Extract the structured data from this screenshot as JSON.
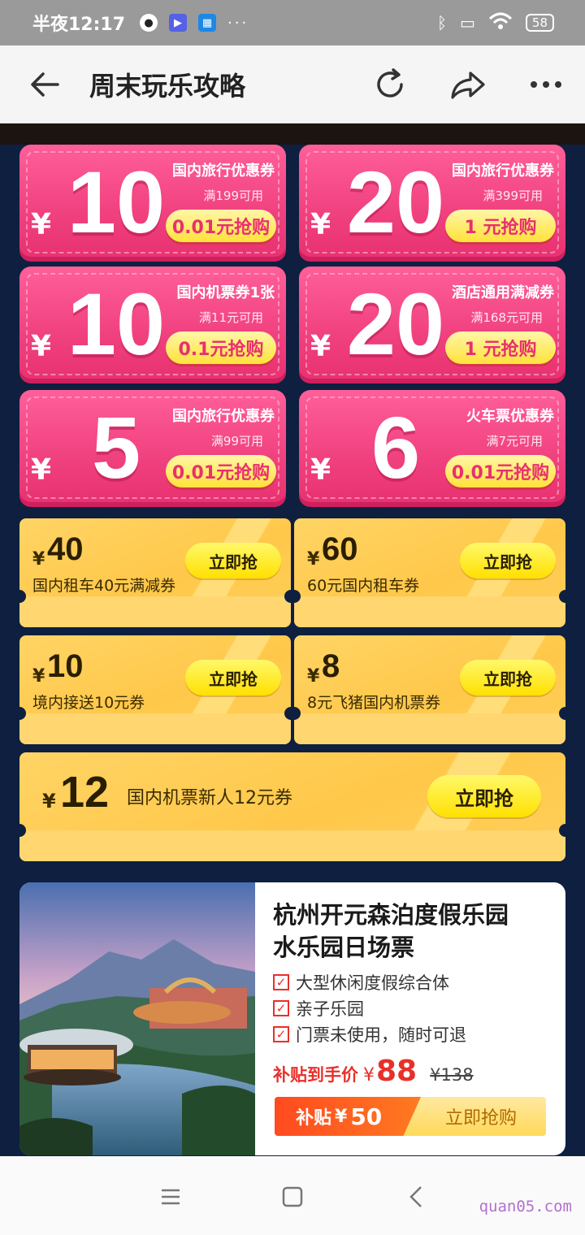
{
  "status": {
    "time": "半夜12:17",
    "app_icons": [
      "qq-icon",
      "video-app-icon",
      "windows-app-icon"
    ],
    "more": "···",
    "battery": "58"
  },
  "header": {
    "title": "周末玩乐攻略",
    "icons": [
      "back-arrow-icon",
      "refresh-icon",
      "share-icon",
      "more-icon"
    ]
  },
  "pink_coupons": [
    {
      "yen": "¥",
      "amount": "10",
      "name": "国内旅行优惠券",
      "condition": "满199可用",
      "price": "0.01元抢购"
    },
    {
      "yen": "¥",
      "amount": "20",
      "name": "国内旅行优惠券",
      "condition": "满399可用",
      "price": "1 元抢购"
    },
    {
      "yen": "¥",
      "amount": "10",
      "name": "国内机票券1张",
      "condition": "满11元可用",
      "price": "0.1元抢购"
    },
    {
      "yen": "¥",
      "amount": "20",
      "name": "酒店通用满减券",
      "condition": "满168元可用",
      "price": "1 元抢购"
    },
    {
      "yen": "¥",
      "amount": "5",
      "name": "国内旅行优惠券",
      "condition": "满99可用",
      "price": "0.01元抢购"
    },
    {
      "yen": "¥",
      "amount": "6",
      "name": "火车票优惠券",
      "condition": "满7元可用",
      "price": "0.01元抢购"
    }
  ],
  "yellow_coupons": [
    {
      "yen": "¥",
      "amount": "40",
      "desc": "国内租车40元满减券",
      "button": "立即抢"
    },
    {
      "yen": "¥",
      "amount": "60",
      "desc": "60元国内租车券",
      "button": "立即抢"
    },
    {
      "yen": "¥",
      "amount": "10",
      "desc": "境内接送10元券",
      "button": "立即抢"
    },
    {
      "yen": "¥",
      "amount": "8",
      "desc": "8元飞猪国内机票券",
      "button": "立即抢"
    }
  ],
  "wide_coupon": {
    "yen": "¥",
    "amount": "12",
    "desc": "国内机票新人12元券",
    "button": "立即抢"
  },
  "product": {
    "name_line1": "杭州开元森泊度假乐园",
    "name_line2": "水乐园日场票",
    "features": [
      "大型休闲度假综合体",
      "亲子乐园",
      "门票未使用，随时可退"
    ],
    "price_label": "补贴到手价",
    "currency": "¥",
    "price": "88",
    "original_price": "¥138",
    "subsidy_label": "补贴",
    "subsidy_currency": "¥",
    "subsidy_amount": "50",
    "buy_label": "立即抢购",
    "image": "resort-lake-mountain-photo"
  },
  "watermark": "quan05.com"
}
